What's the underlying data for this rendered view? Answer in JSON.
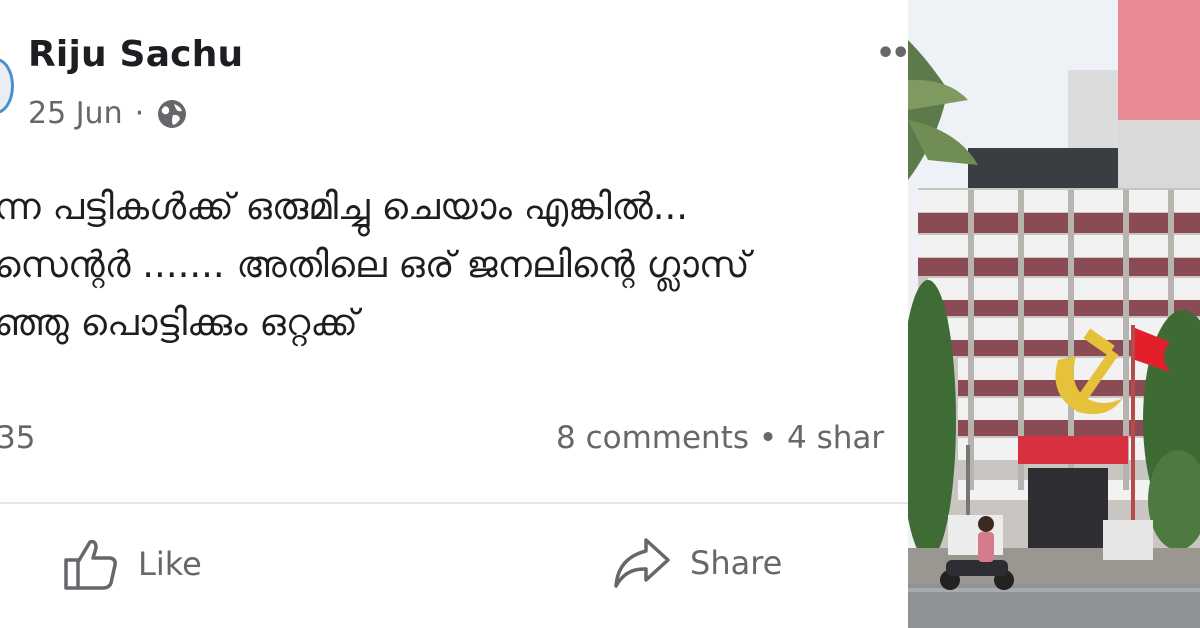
{
  "post": {
    "author": "Riju Sachu",
    "date": "25 Jun",
    "separator": "·",
    "privacy_icon": "globe-icon",
    "more_label": "••",
    "lines": [
      "ന്ന പട്ടികൾക്ക് ഒരുമിച്ചു ചെയാം എങ്കിൽ...",
      "സെന്റർ ....... അതിലെ ഒര് ജനലിന്റെ ഗ്ലാസ്",
      "ഞ്ഞു പൊട്ടിക്കും ഒറ്റക്ക്"
    ],
    "reaction_count": "35",
    "counts_text": "8 comments • 4 shar"
  },
  "actions": {
    "like_label": "Like",
    "share_label": "Share"
  },
  "photo": {
    "subject": "building-with-hammer-sickle-emblem"
  }
}
